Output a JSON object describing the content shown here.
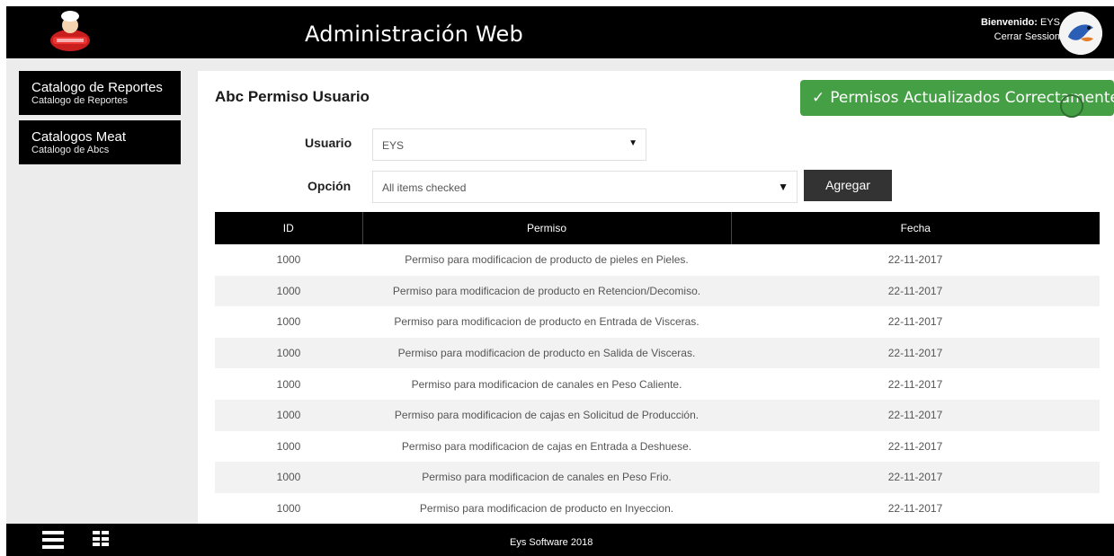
{
  "header": {
    "app_title": "Administración Web",
    "welcome_label": "Bienvenido:",
    "username": "EYS",
    "logout": "Cerrar Session"
  },
  "sidebar": {
    "items": [
      {
        "title": "Catalogo de Reportes",
        "subtitle": "Catalogo de Reportes"
      },
      {
        "title": "Catalogos Meat",
        "subtitle": "Catalogo de Abcs"
      }
    ]
  },
  "page": {
    "title": "Abc Permiso Usuario",
    "toast": "Permisos Actualizados Correctamente",
    "usuario_label": "Usuario",
    "usuario_value": "EYS",
    "opcion_label": "Opción",
    "opcion_value": "All items checked",
    "add_button": "Agregar"
  },
  "table": {
    "headers": [
      "ID",
      "Permiso",
      "Fecha"
    ],
    "rows": [
      {
        "id": "1000",
        "permiso": "Permiso para modificacion de producto de pieles en Pieles.",
        "fecha": "22-11-2017"
      },
      {
        "id": "1000",
        "permiso": "Permiso para modificacion de producto en Retencion/Decomiso.",
        "fecha": "22-11-2017"
      },
      {
        "id": "1000",
        "permiso": "Permiso para modificacion de producto en Entrada de Visceras.",
        "fecha": "22-11-2017"
      },
      {
        "id": "1000",
        "permiso": "Permiso para modificacion de producto en Salida de Visceras.",
        "fecha": "22-11-2017"
      },
      {
        "id": "1000",
        "permiso": "Permiso para modificacion de canales en Peso Caliente.",
        "fecha": "22-11-2017"
      },
      {
        "id": "1000",
        "permiso": "Permiso para modificacion de cajas en Solicitud de Producción.",
        "fecha": "22-11-2017"
      },
      {
        "id": "1000",
        "permiso": "Permiso para modificacion de cajas en Entrada a Deshuese.",
        "fecha": "22-11-2017"
      },
      {
        "id": "1000",
        "permiso": "Permiso para modificacion de canales en Peso Frio.",
        "fecha": "22-11-2017"
      },
      {
        "id": "1000",
        "permiso": "Permiso para modificacion de producto en Inyeccion.",
        "fecha": "22-11-2017"
      }
    ]
  },
  "footer": {
    "text": "Eys Software 2018"
  },
  "colors": {
    "header_bg": "#000000",
    "toast_bg": "#45a045",
    "button_bg": "#333333",
    "stripe": "#f2f2f2"
  },
  "icons": {
    "logo": "chef-logo-icon",
    "avatar": "bird-avatar-icon",
    "check": "check-icon",
    "menu": "hamburger-icon",
    "apps": "grid-icon"
  }
}
